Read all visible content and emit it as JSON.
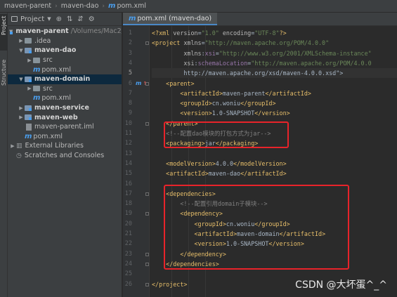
{
  "breadcrumb": {
    "items": [
      "maven-parent",
      "maven-dao",
      "pom.xml"
    ],
    "file_icon": "m"
  },
  "tool_strip": {
    "tabs": [
      "Project",
      "Structure"
    ]
  },
  "project_panel": {
    "toolbar": {
      "view_label": "Project",
      "dropdown_icon": "chevron-down-icon",
      "icons": [
        "target-icon",
        "collapse-icon",
        "expand-icon",
        "gear-icon"
      ]
    },
    "tree": [
      {
        "label": "maven-parent",
        "hint": "/Volumes/Mac2/",
        "kind": "module-root",
        "expanded": true
      },
      {
        "label": ".idea",
        "kind": "folder",
        "expanded": false
      },
      {
        "label": "maven-dao",
        "kind": "module",
        "expanded": true
      },
      {
        "label": "src",
        "kind": "folder",
        "expanded": false
      },
      {
        "label": "pom.xml",
        "kind": "pom"
      },
      {
        "label": "maven-domain",
        "kind": "module",
        "expanded": true
      },
      {
        "label": "src",
        "kind": "folder",
        "expanded": false
      },
      {
        "label": "pom.xml",
        "kind": "pom"
      },
      {
        "label": "maven-service",
        "kind": "module",
        "expanded": false
      },
      {
        "label": "maven-web",
        "kind": "module",
        "expanded": false
      },
      {
        "label": "maven-parent.iml",
        "kind": "iml"
      },
      {
        "label": "pom.xml",
        "kind": "pom"
      },
      {
        "label": "External Libraries",
        "kind": "libraries",
        "expanded": false
      },
      {
        "label": "Scratches and Consoles",
        "kind": "scratches"
      }
    ]
  },
  "editor": {
    "tab_label": "pom.xml (maven-dao)",
    "line_numbers": [
      "1",
      "2",
      "3",
      "4",
      "5",
      "6",
      "7",
      "8",
      "9",
      "10",
      "11",
      "12",
      "13",
      "14",
      "15",
      "16",
      "17",
      "18",
      "19",
      "20",
      "21",
      "22",
      "23",
      "24",
      "25",
      "26"
    ],
    "lines": [
      "<?xml version=\"1.0\" encoding=\"UTF-8\"?>",
      "<project xmlns=\"http://maven.apache.org/POM/4.0.0\"",
      "         xmlns:xsi=\"http://www.w3.org/2001/XMLSchema-instance\"",
      "         xsi:schemaLocation=\"http://maven.apache.org/POM/4.0.0",
      "         http://maven.apache.org/xsd/maven-4.0.0.xsd\">",
      "    <parent>",
      "        <artifactId>maven-parent</artifactId>",
      "        <groupId>cn.woniu</groupId>",
      "        <version>1.0-SNAPSHOT</version>",
      "    </parent>",
      "    <!--配置dao模块的打包方式为jar-->",
      "    <packaging>jar</packaging>",
      "",
      "    <modelVersion>4.0.0</modelVersion>",
      "    <artifactId>maven-dao</artifactId>",
      "",
      "    <dependencies>",
      "        <!--配置引用domain子模块-->",
      "        <dependency>",
      "            <groupId>cn.woniu</groupId>",
      "            <artifactId>maven-domain</artifactId>",
      "            <version>1.0-SNAPSHOT</version>",
      "        </dependency>",
      "    </dependencies>",
      "",
      "</project>"
    ]
  },
  "watermark": "CSDN @大坏蛋^_^",
  "colors": {
    "highlight_box": "#e8232a",
    "tag": "#e8bf6a",
    "value": "#6a8759",
    "comment": "#808080",
    "namespace": "#9876aa"
  }
}
